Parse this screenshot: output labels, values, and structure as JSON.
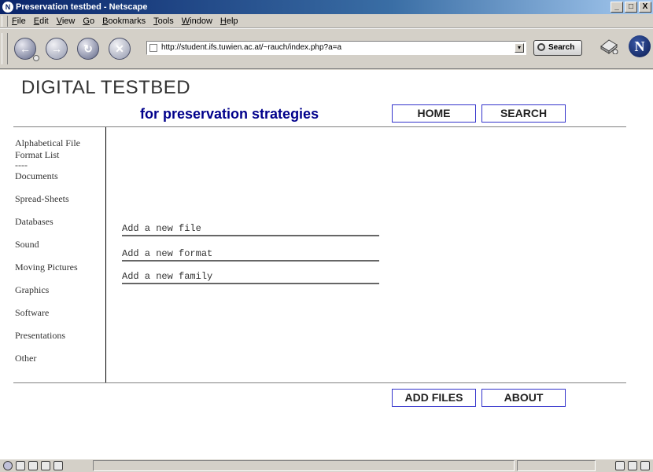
{
  "window": {
    "title": "Preservation testbed - Netscape",
    "controls": [
      "_",
      "□",
      "X"
    ]
  },
  "menubar": {
    "items": [
      {
        "label": "File",
        "mnemonic": "F"
      },
      {
        "label": "Edit",
        "mnemonic": "E"
      },
      {
        "label": "View",
        "mnemonic": "V"
      },
      {
        "label": "Go",
        "mnemonic": "G"
      },
      {
        "label": "Bookmarks",
        "mnemonic": "B"
      },
      {
        "label": "Tools",
        "mnemonic": "T"
      },
      {
        "label": "Window",
        "mnemonic": "W"
      },
      {
        "label": "Help",
        "mnemonic": "H"
      }
    ]
  },
  "toolbar": {
    "url": "http://student.ifs.tuwien.ac.at/~rauch/index.php?a=a",
    "search_label": "Search",
    "icons": [
      "back-icon",
      "forward-icon",
      "reload-icon",
      "stop-icon",
      "print-icon",
      "netscape-logo-icon"
    ]
  },
  "page": {
    "title": "DIGITAL TESTBED",
    "subtitle": "for preservation strategies",
    "top_nav": {
      "home": "HOME",
      "search": "SEARCH"
    },
    "bottom_nav": {
      "add_files": "ADD FILES",
      "about": "ABOUT"
    },
    "sidebar": {
      "alpha_list": "Alphabetical File Format List",
      "separator": "----",
      "items": [
        "Documents",
        "Spread-Sheets",
        "Databases",
        "Sound",
        "Moving Pictures",
        "Graphics",
        "Software",
        "Presentations",
        "Other"
      ]
    },
    "actions": [
      "Add a new file",
      "Add a new format",
      "Add a new family"
    ]
  },
  "colors": {
    "title_bar": "#0a246a",
    "subtitle": "#00008b",
    "button_border": "#3333cc"
  }
}
